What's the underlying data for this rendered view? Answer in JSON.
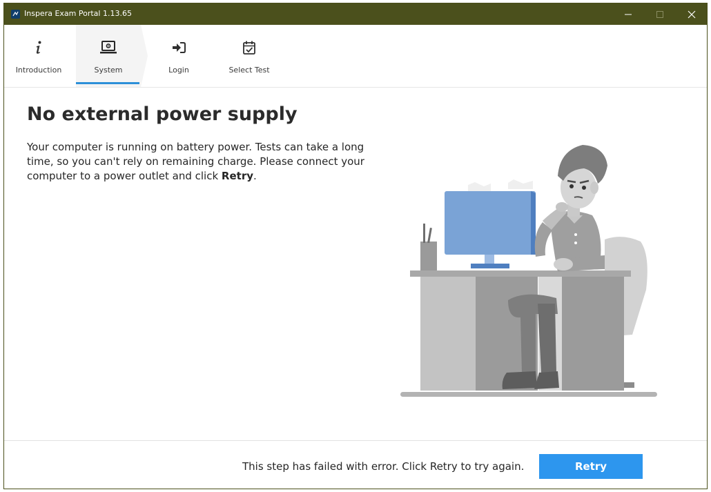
{
  "window": {
    "title": "Inspera Exam Portal 1.13.65",
    "controls": [
      "minimize-icon",
      "maximize-icon",
      "close-icon"
    ]
  },
  "tabs": [
    {
      "label": "Introduction",
      "icon": "info-icon",
      "active": false
    },
    {
      "label": "System",
      "icon": "laptop-gear-icon",
      "active": true
    },
    {
      "label": "Login",
      "icon": "login-arrow-icon",
      "active": false
    },
    {
      "label": "Select Test",
      "icon": "calendar-check-icon",
      "active": false
    }
  ],
  "main": {
    "heading": "No external power supply",
    "message_text": "Your computer is running on battery power. Tests can take a long time, so you can't rely on remaining charge. Please connect your computer to a power outlet and click ",
    "message_emphasis": "Retry",
    "message_end": ".",
    "illustration": "person-at-desk-computer-illustration"
  },
  "footer": {
    "status": "This step has failed with error. Click Retry to try again.",
    "retry_label": "Retry"
  },
  "colors": {
    "titlebar": "#4b501c",
    "accent": "#2d96ee",
    "tab_underline": "#2c8fd8",
    "active_tab_bg": "#f4f4f4",
    "monitor": "#7aa3d6"
  }
}
